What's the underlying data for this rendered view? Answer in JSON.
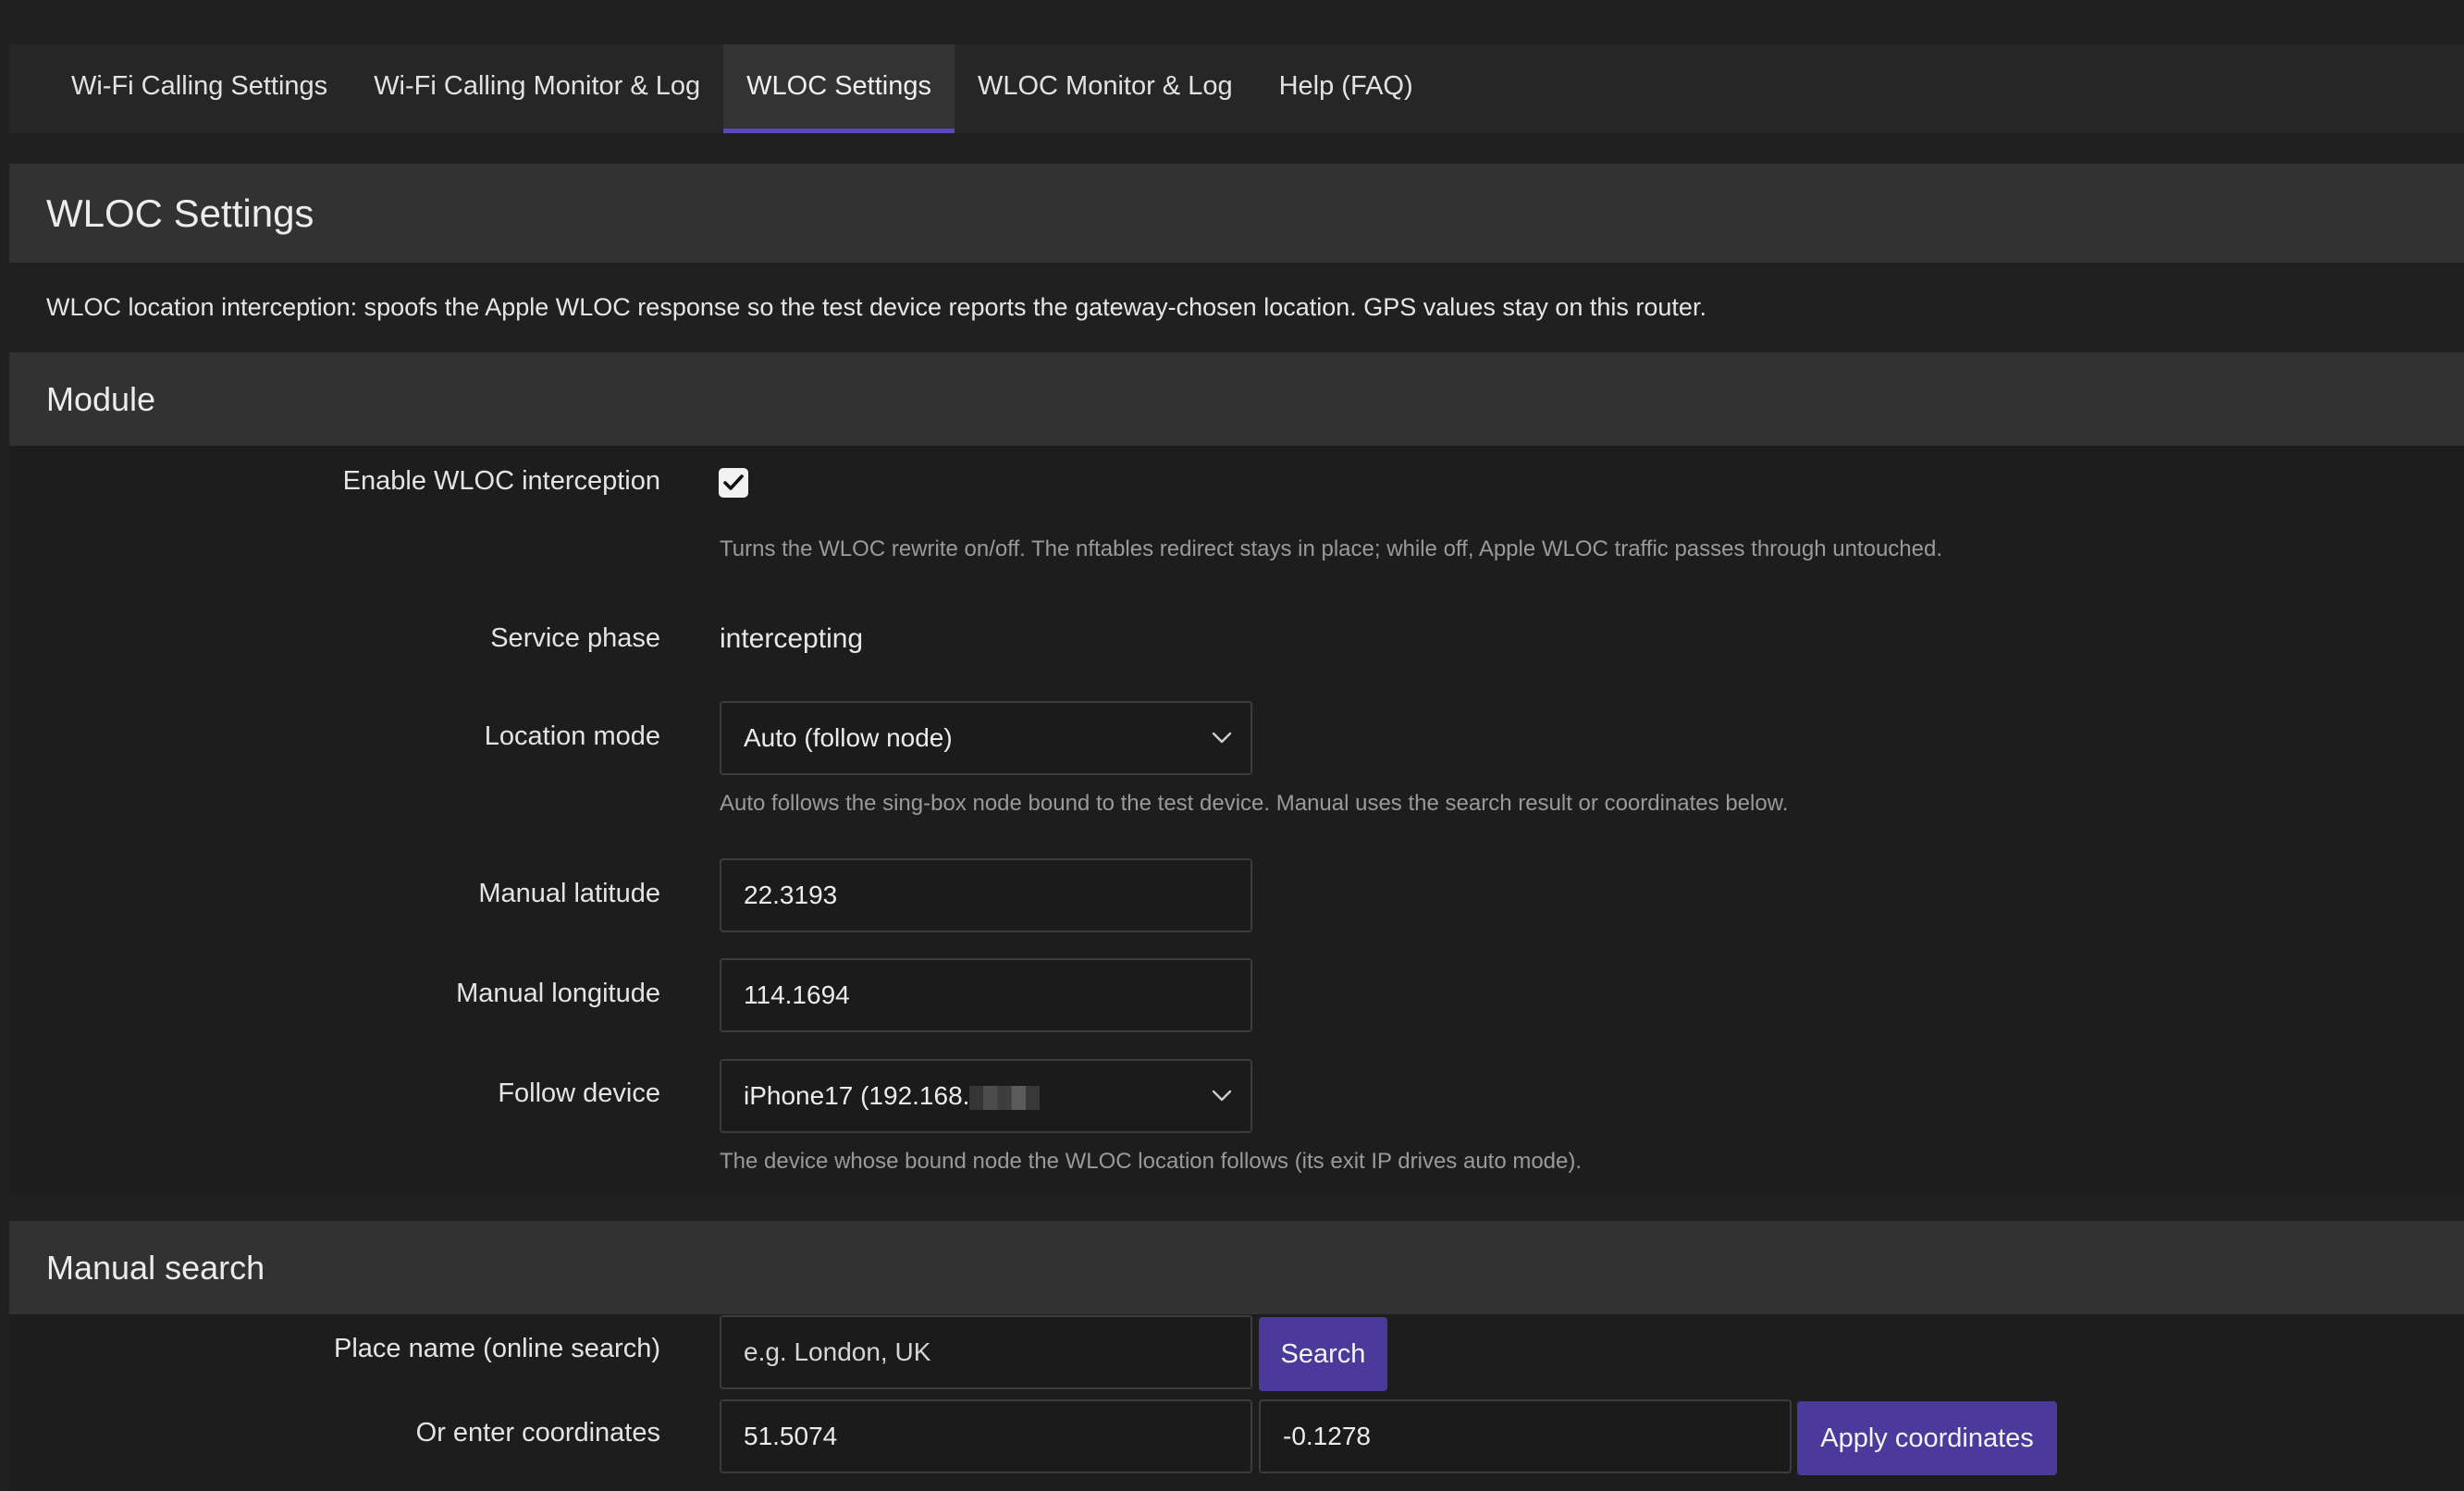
{
  "tabs": [
    {
      "label": "Wi-Fi Calling Settings",
      "active": false
    },
    {
      "label": "Wi-Fi Calling Monitor & Log",
      "active": false
    },
    {
      "label": "WLOC Settings",
      "active": true
    },
    {
      "label": "WLOC Monitor & Log",
      "active": false
    },
    {
      "label": "Help (FAQ)",
      "active": false
    }
  ],
  "page": {
    "title": "WLOC Settings",
    "description": "WLOC location interception: spoofs the Apple WLOC response so the test device reports the gateway-chosen location. GPS values stay on this router."
  },
  "module": {
    "heading": "Module",
    "enable": {
      "label": "Enable WLOC interception",
      "checked": true,
      "hint": "Turns the WLOC rewrite on/off. The nftables redirect stays in place; while off, Apple WLOC traffic passes through untouched."
    },
    "phase": {
      "label": "Service phase",
      "value": "intercepting"
    },
    "location_mode": {
      "label": "Location mode",
      "value": "Auto (follow node)",
      "hint": "Auto follows the sing-box node bound to the test device. Manual uses the search result or coordinates below."
    },
    "manual_latitude": {
      "label": "Manual latitude",
      "value": "22.3193"
    },
    "manual_longitude": {
      "label": "Manual longitude",
      "value": "114.1694"
    },
    "follow_device": {
      "label": "Follow device",
      "value": "iPhone17 (192.168.",
      "hint": "The device whose bound node the WLOC location follows (its exit IP drives auto mode)."
    }
  },
  "manual_search": {
    "heading": "Manual search",
    "place": {
      "label": "Place name (online search)",
      "placeholder": "e.g. London, UK",
      "button": "Search"
    },
    "coords": {
      "label": "Or enter coordinates",
      "lat": "51.5074",
      "lon": "-0.1278",
      "button": "Apply coordinates"
    }
  },
  "colors": {
    "accent": "#4b3a9c",
    "tab_underline": "#5b48b8",
    "background": "#202020"
  },
  "icons": {
    "select_arrow": "chevron-down-icon",
    "checkbox": "checkmark-icon"
  }
}
